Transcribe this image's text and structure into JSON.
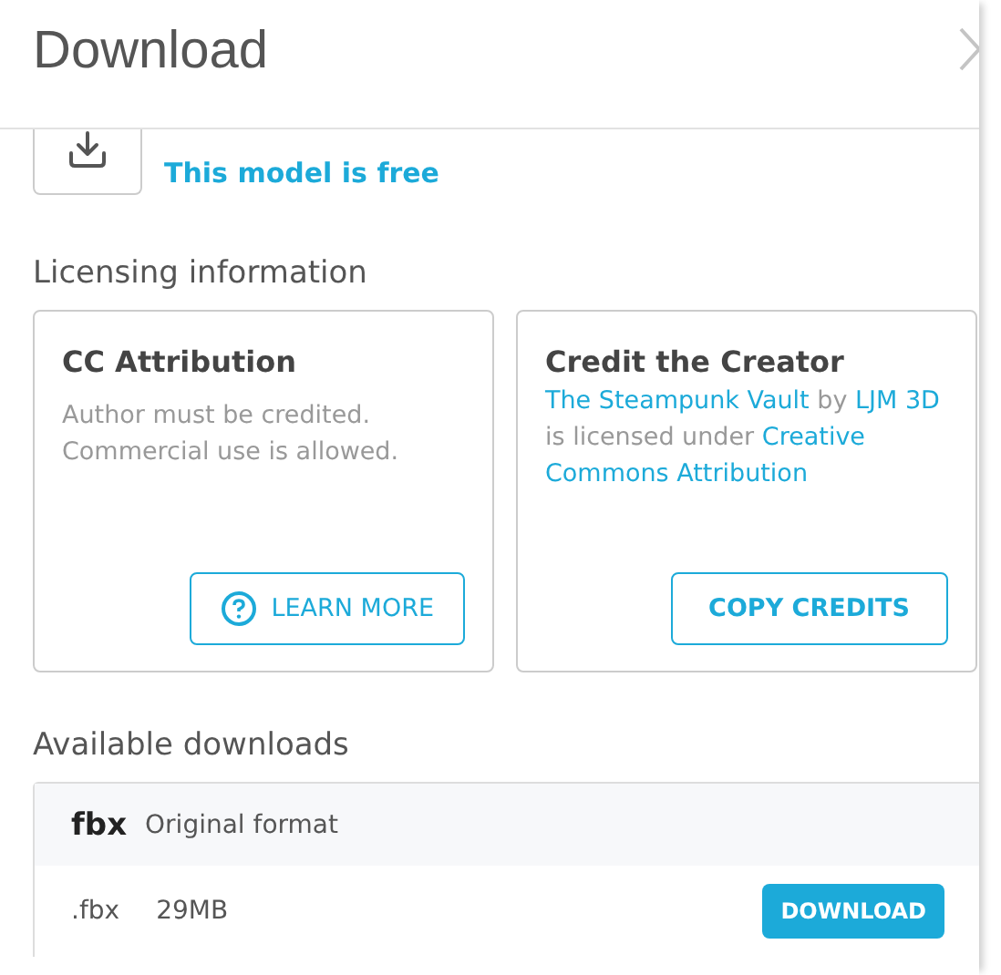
{
  "header": {
    "title": "Download"
  },
  "model": {
    "price_note": "This model is free"
  },
  "licensing": {
    "heading": "Licensing information",
    "license": {
      "title": "CC Attribution",
      "description": "Author must be credited. Commercial use is allowed.",
      "button": "LEARN MORE"
    },
    "credit": {
      "title": "Credit the Creator",
      "lines": [
        [
          {
            "kind": "link",
            "text": "The Steampunk Vault"
          },
          {
            "kind": "text",
            "text": " by "
          },
          {
            "kind": "link",
            "text": "LJM 3D"
          }
        ],
        [
          {
            "kind": "text",
            "text": "is licensed under "
          },
          {
            "kind": "link",
            "text": "Creative"
          }
        ],
        [
          {
            "kind": "link",
            "text": "Commons Attribution"
          }
        ]
      ],
      "button": "COPY CREDITS"
    }
  },
  "downloads": {
    "heading": "Available downloads",
    "format": "fbx",
    "format_note": "Original format",
    "files": [
      {
        "extension": ".fbx",
        "size": "29MB",
        "button": "DOWNLOAD"
      }
    ]
  }
}
